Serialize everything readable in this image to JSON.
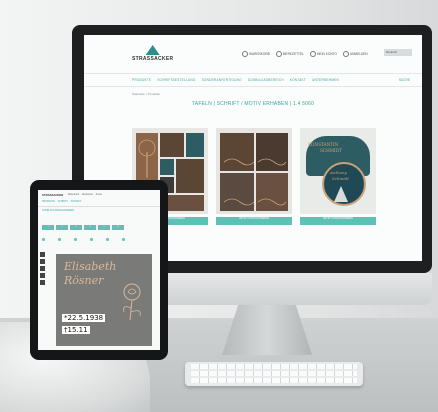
{
  "site": {
    "logo": "STRASSACKER",
    "header_links": [
      "WARENKORB",
      "MERKZETTEL",
      "MEIN KONTO",
      "ANMELDEN"
    ],
    "language_select": "Deutsch",
    "nav": [
      "PRODUKTE",
      "SCHRIFTBESTELLUNG",
      "SONDERANFERTIGUNG",
      "DOWNLOADBEREICH",
      "KONTAKT",
      "UNTERNEHMEN"
    ],
    "nav_right": "SUCHE",
    "breadcrumb": "Startseite > Produkte",
    "page_title": "TAFELN | SCHRIFT / MOTIV ERHABEN | 1.4 5060",
    "cards": [
      {
        "button": "JETZT KONFIGURIEREN"
      },
      {
        "button": "JETZT KONFIGURIEREN"
      },
      {
        "button": "JETZT KONFIGURIEREN"
      }
    ],
    "card3_text": [
      "KONSTANTIN",
      "SCHMIDT",
      "Anthony",
      "Schmidt"
    ]
  },
  "tablet": {
    "logo": "STRASSACKER",
    "top_links": [
      "Warenkorb",
      "Merkzettel",
      "Konto"
    ],
    "nav": [
      "PRODUKTE",
      "SCHRIFT",
      "KONTAKT"
    ],
    "title": "TAFELN KONFIGURIEREN",
    "steps": [
      "1",
      "2",
      "3",
      "4",
      "5",
      "6"
    ],
    "name_line1": "Elisabeth",
    "name_line2": "Rösner",
    "date1": "*22.5.1938",
    "date2": "†15.11"
  },
  "colors": {
    "accent": "#3aa89e",
    "button": "#5fc0b5",
    "plaque_brown": "#5b4636",
    "plaque_teal": "#2d5d63",
    "bronze": "#c9a27a"
  }
}
